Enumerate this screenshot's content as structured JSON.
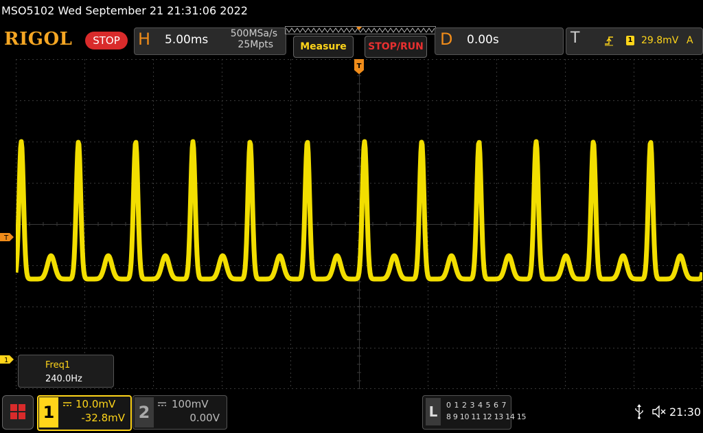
{
  "titlebar": {
    "title": "MSO5102  Wed September 21 21:31:06 2022"
  },
  "toolbar": {
    "logo": "RIGOL",
    "run_state": "STOP",
    "horizontal": {
      "letter": "H",
      "timebase": "5.00ms",
      "sample_rate": "500MSa/s",
      "memory_depth": "25Mpts"
    },
    "measure_label": "Measure",
    "stop_run_label": "STOP/RUN",
    "delay": {
      "letter": "D",
      "value": "0.00s"
    },
    "trigger": {
      "letter": "T",
      "slope_icon": "rising-edge-icon",
      "source": "1",
      "level": "29.8mV",
      "mode": "A"
    }
  },
  "screen": {
    "trigger_marker": "T",
    "trigger_position_marker": "T",
    "channel1_marker": "1",
    "trace_color": "#ffea00",
    "grid_color": "#3a3a3a"
  },
  "measurement": {
    "name": "Freq1",
    "value": "240.0Hz"
  },
  "channels": {
    "ch1": {
      "number": "1",
      "scale": "10.0mV",
      "offset": "-32.8mV",
      "color": "#ffd51a"
    },
    "ch2": {
      "number": "2",
      "scale": "100mV",
      "offset": "0.00V"
    }
  },
  "logic_analyzer": {
    "letter": "L",
    "row1": "0 1 2 3  4 5 6 7",
    "row2": "8 9 10 11 12 13 14 15"
  },
  "status": {
    "time": "21:30",
    "usb_icon": "usb-icon",
    "speaker_icon": "speaker-muted-icon"
  }
}
